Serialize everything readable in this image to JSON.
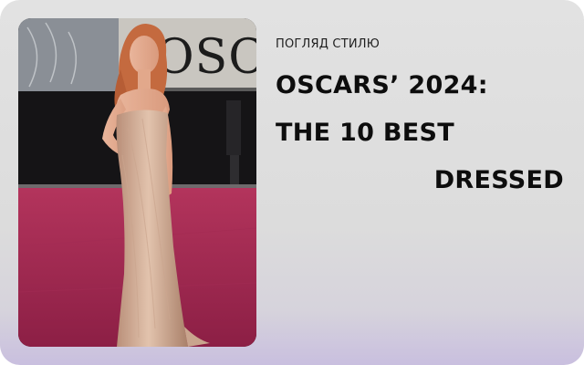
{
  "card": {
    "eyebrow": "ПОГЛЯД СТИЛЮ",
    "headline": {
      "line1": "OSCARS’ 2024:",
      "line2": "THE 10 BEST",
      "line3": "DRESSED"
    },
    "photo": {
      "backdrop_text": "OSCARS"
    }
  }
}
